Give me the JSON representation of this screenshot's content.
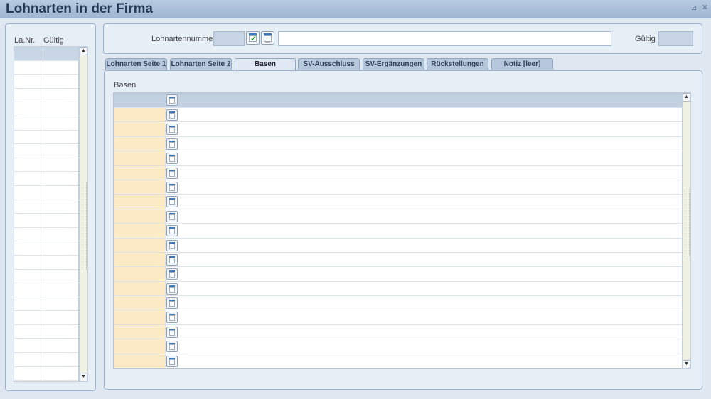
{
  "window": {
    "title": "Lohnarten in der Firma",
    "pin_glyph": "⊿",
    "close_glyph": "✕"
  },
  "left_list": {
    "headers": {
      "la_nr": "La.Nr.",
      "gueltig": "Gültig"
    },
    "row_count": 24
  },
  "top": {
    "lohnartennummer_label": "Lohnartennummer",
    "lohnartennummer_value": "",
    "description_value": "",
    "gueltig_label": "Gültig",
    "gueltig_value": ""
  },
  "tabs": [
    {
      "label": "Lohnarten Seite 1",
      "active": false
    },
    {
      "label": "Lohnarten Seite 2",
      "active": false
    },
    {
      "label": "Basen",
      "active": true
    },
    {
      "label": "SV-Ausschluss",
      "active": false
    },
    {
      "label": "SV-Ergänzungen",
      "active": false
    },
    {
      "label": "Rückstellungen",
      "active": false
    },
    {
      "label": "Notiz [leer]",
      "active": false
    }
  ],
  "basen": {
    "section_label": "Basen",
    "row_count": 18
  },
  "icons": {
    "confirm": "calendar-check-icon",
    "lookup": "calendar-list-icon",
    "row": "row-detail-icon",
    "scroll_up": "scroll-up-icon",
    "scroll_down": "scroll-down-icon"
  }
}
